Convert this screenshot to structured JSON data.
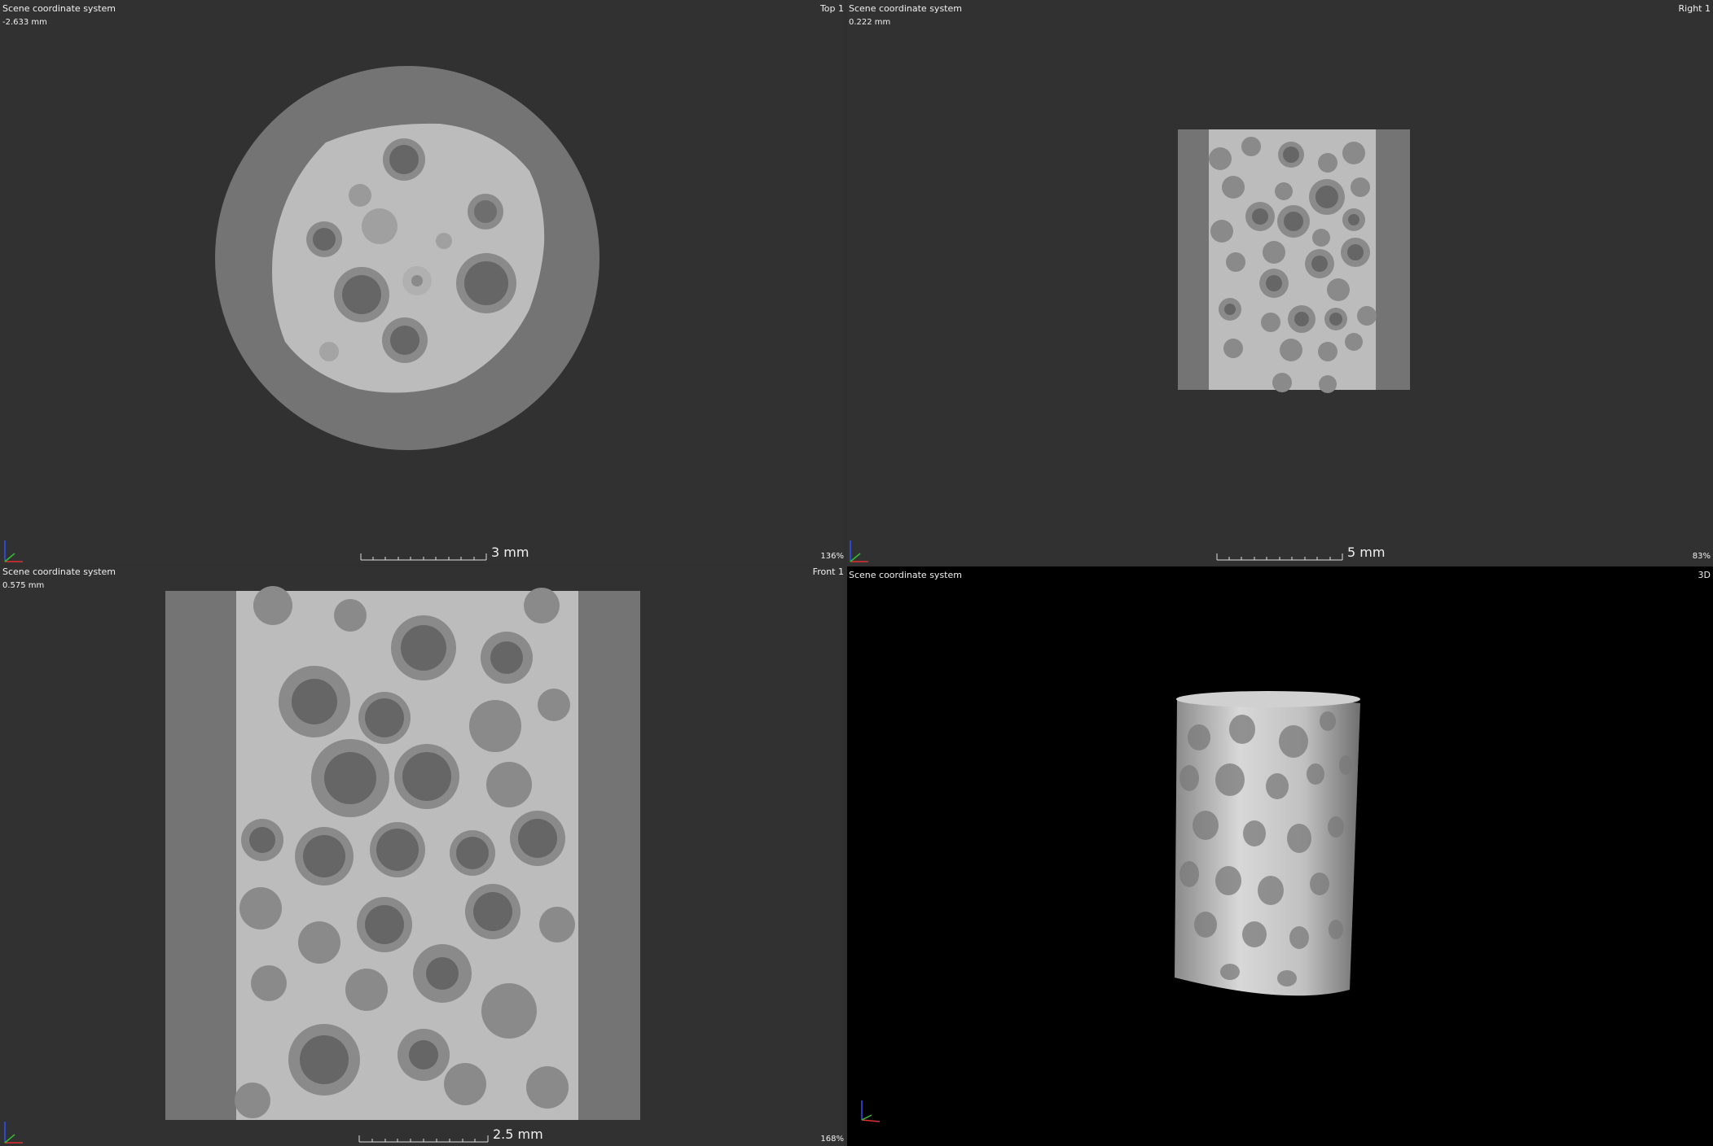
{
  "viewports": {
    "top": {
      "coord_system": "Scene coordinate system",
      "position": "-2.633 mm",
      "name": "Top 1",
      "zoom": "136%",
      "scale_label": "3 mm"
    },
    "right": {
      "coord_system": "Scene coordinate system",
      "position": "0.222 mm",
      "name": "Right 1",
      "zoom": "83%",
      "scale_label": "5 mm"
    },
    "front": {
      "coord_system": "Scene coordinate system",
      "position": "0.575 mm",
      "name": "Front 1",
      "zoom": "168%",
      "scale_label": "2.5 mm"
    },
    "three_d": {
      "coord_system": "Scene coordinate system",
      "name": "3D"
    }
  },
  "axes_colors": {
    "x": "#e03030",
    "y": "#30c030",
    "z": "#3050ff"
  },
  "icons": [
    "axes-triad-icon"
  ]
}
